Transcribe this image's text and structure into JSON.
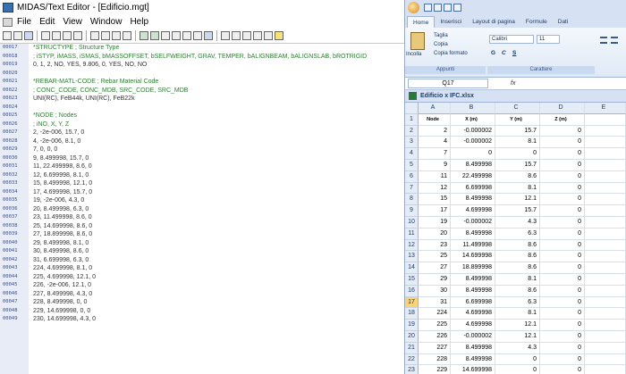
{
  "editor": {
    "title": "MIDAS/Text Editor - [Edificio.mgt]",
    "menu": [
      "File",
      "Edit",
      "View",
      "Window",
      "Help"
    ],
    "line_numbers": [
      "00017",
      "00018",
      "00019",
      "00020",
      "00021",
      "00022",
      "00023",
      "00024",
      "00025",
      "00026",
      "00027",
      "00028",
      "00029",
      "00030",
      "00031",
      "00032",
      "00033",
      "00034",
      "00035",
      "00036",
      "00037",
      "00038",
      "00039",
      "00040",
      "00041",
      "00042",
      "00043",
      "00044",
      "00045",
      "00046",
      "00047",
      "00048",
      "00049"
    ],
    "lines": [
      {
        "text": "*STRUCTYPE    ; Structure Type",
        "type": "kw"
      },
      {
        "text": "; iSTYP, iMASS, iSMAS, bMASSOFFSET, bSELFWEIGHT, GRAV, TEMPER, bALIGNBEAM, bALIGNSLAB, bROTRIGID",
        "type": "cm"
      },
      {
        "text": "   0, 1, 2, NO, YES, 9.806, 0, YES, NO, NO",
        "type": "tx"
      },
      {
        "text": "",
        "type": "tx"
      },
      {
        "text": "*REBAR-MATL-CODE    ; Rebar Material Code",
        "type": "kw"
      },
      {
        "text": "; CONC_CODE, CONC_MDB, SRC_CODE, SRC_MDB",
        "type": "cm"
      },
      {
        "text": "  UNI(RC), FeB44k, UNI(RC), FeB22k",
        "type": "tx"
      },
      {
        "text": "",
        "type": "tx"
      },
      {
        "text": "*NODE    ; Nodes",
        "type": "kw"
      },
      {
        "text": "; iNO, X, Y, Z",
        "type": "cm"
      },
      {
        "text": "   2, -2e-006, 15.7, 0",
        "type": "tx"
      },
      {
        "text": "   4, -2e-006, 8.1, 0",
        "type": "tx"
      },
      {
        "text": "   7, 0, 0, 0",
        "type": "tx"
      },
      {
        "text": "   9, 8.499998, 15.7, 0",
        "type": "tx"
      },
      {
        "text": "   11, 22.499998, 8.6, 0",
        "type": "tx"
      },
      {
        "text": "   12, 6.699998, 8.1, 0",
        "type": "tx"
      },
      {
        "text": "   15, 8.499998, 12.1, 0",
        "type": "tx"
      },
      {
        "text": "   17, 4.699998, 15.7, 0",
        "type": "tx"
      },
      {
        "text": "   19, -2e-006, 4.3, 0",
        "type": "tx"
      },
      {
        "text": "   20, 8.499998, 6.3, 0",
        "type": "tx"
      },
      {
        "text": "   23, 11.499998, 8.6, 0",
        "type": "tx"
      },
      {
        "text": "   25, 14.699998, 8.6, 0",
        "type": "tx"
      },
      {
        "text": "   27, 18.899998, 8.6, 0",
        "type": "tx"
      },
      {
        "text": "   29, 8.499998, 8.1, 0",
        "type": "tx"
      },
      {
        "text": "   30, 8.499998, 8.6, 0",
        "type": "tx"
      },
      {
        "text": "   31, 6.699998, 6.3, 0",
        "type": "tx"
      },
      {
        "text": "   224, 4.699998, 8.1, 0",
        "type": "tx"
      },
      {
        "text": "   225, 4.699998, 12.1, 0",
        "type": "tx"
      },
      {
        "text": "   226, -2e-006, 12.1, 0",
        "type": "tx"
      },
      {
        "text": "   227, 8.499998, 4.3, 0",
        "type": "tx"
      },
      {
        "text": "   228, 8.499998, 0, 0",
        "type": "tx"
      },
      {
        "text": "   229, 14.699998, 0, 0",
        "type": "tx"
      },
      {
        "text": "   230, 14.699998, 4.3, 0",
        "type": "tx"
      }
    ]
  },
  "excel": {
    "tabs": [
      "Home",
      "Inserisci",
      "Layout di pagina",
      "Formule",
      "Dati"
    ],
    "ribbon": {
      "paste": "Incolla",
      "cut": "Taglia",
      "copy": "Copia",
      "format_painter": "Copia formato",
      "clipboard_group": "Appunti",
      "font_name": "Calibri",
      "font_size": "11",
      "font_group": "Carattere",
      "bold": "G",
      "italic": "C",
      "underline": "S"
    },
    "name_box": "Q17",
    "fx": "fx",
    "document_title": "Edificio x IFC.xlsx",
    "columns": [
      "A",
      "B",
      "C",
      "D",
      "E"
    ],
    "header_row": [
      "Node",
      "X (m)",
      "Y (m)",
      "Z (m)"
    ],
    "selected_row": "17",
    "rows": [
      [
        "2",
        "-0.000002",
        "15.7",
        "0"
      ],
      [
        "4",
        "-0.000002",
        "8.1",
        "0"
      ],
      [
        "7",
        "0",
        "0",
        "0"
      ],
      [
        "9",
        "8.499998",
        "15.7",
        "0"
      ],
      [
        "11",
        "22.499998",
        "8.6",
        "0"
      ],
      [
        "12",
        "6.699998",
        "8.1",
        "0"
      ],
      [
        "15",
        "8.499998",
        "12.1",
        "0"
      ],
      [
        "17",
        "4.699998",
        "15.7",
        "0"
      ],
      [
        "19",
        "-0.000002",
        "4.3",
        "0"
      ],
      [
        "20",
        "8.499998",
        "6.3",
        "0"
      ],
      [
        "23",
        "11.499998",
        "8.6",
        "0"
      ],
      [
        "25",
        "14.699998",
        "8.6",
        "0"
      ],
      [
        "27",
        "18.899998",
        "8.6",
        "0"
      ],
      [
        "29",
        "8.499998",
        "8.1",
        "0"
      ],
      [
        "30",
        "8.499998",
        "8.6",
        "0"
      ],
      [
        "31",
        "6.699998",
        "6.3",
        "0"
      ],
      [
        "224",
        "4.699998",
        "8.1",
        "0"
      ],
      [
        "225",
        "4.699998",
        "12.1",
        "0"
      ],
      [
        "226",
        "-0.000002",
        "12.1",
        "0"
      ],
      [
        "227",
        "8.499998",
        "4.3",
        "0"
      ],
      [
        "228",
        "8.499998",
        "0",
        "0"
      ],
      [
        "229",
        "14.699998",
        "0",
        "0"
      ]
    ]
  }
}
